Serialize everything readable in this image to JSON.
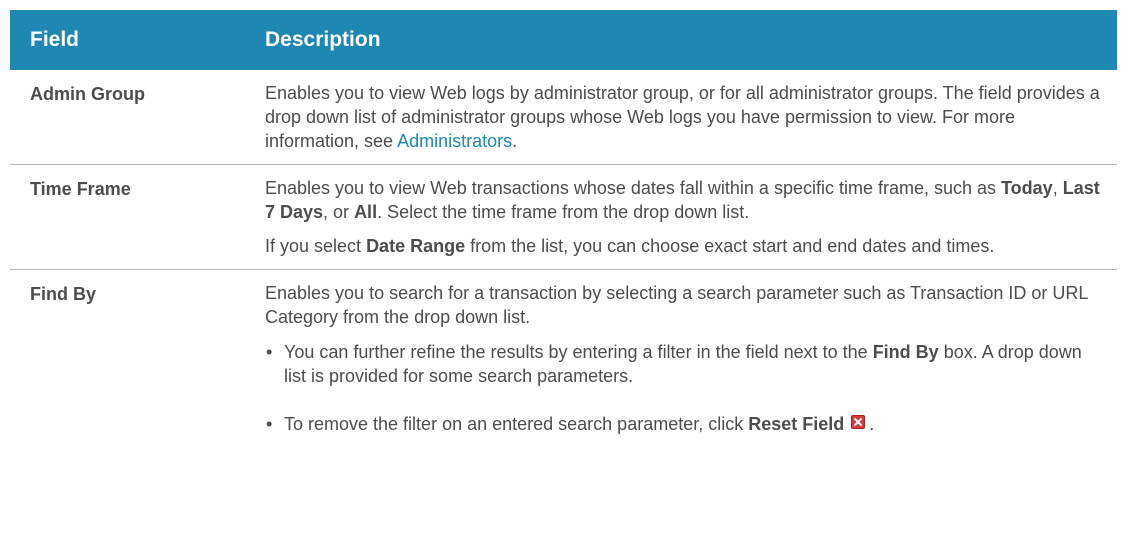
{
  "table": {
    "headers": {
      "field": "Field",
      "description": "Description"
    },
    "rows": [
      {
        "field": "Admin Group",
        "text_1": "Enables you to view Web logs by administrator group, or for all administrator groups. The field provides a drop down list of administrator groups whose Web logs you have permission to view. For more information, see ",
        "link": "Administrators",
        "text_2": "."
      },
      {
        "field": "Time Frame",
        "p1_a": "Enables you to view Web transactions whose dates fall within a specific time frame, such as ",
        "p1_b1": "Today",
        "p1_sep1": ", ",
        "p1_b2": "Last 7 Days",
        "p1_sep2": ", or ",
        "p1_b3": "All",
        "p1_c": ". Select the time frame from the drop down list.",
        "p2_a": "If you select ",
        "p2_b": "Date Range",
        "p2_c": " from the list, you can choose exact start and end dates and times."
      },
      {
        "field": "Find By",
        "p1": "Enables you to search for a transaction by selecting a search parameter such as Transaction ID or URL Category from the drop down list.",
        "bullet_char": "•",
        "bullet1_a": "You can further refine the results by entering a filter in the field next to the ",
        "bullet1_b": "Find By",
        "bullet1_c": " box. A drop down list is provided for some search parameters.",
        "bullet2_a": "To remove the filter on an entered search parameter, click ",
        "bullet2_b": "Reset Field",
        "bullet2_icon": "reset-field-icon",
        "bullet2_c": "."
      }
    ]
  },
  "colors": {
    "header_bg": "#1e87b3",
    "header_text": "#ffffff",
    "body_text": "#4d4d4d",
    "link": "#1e87b3",
    "row_divider": "#b7b7b7",
    "reset_icon": "#d63b3b"
  }
}
